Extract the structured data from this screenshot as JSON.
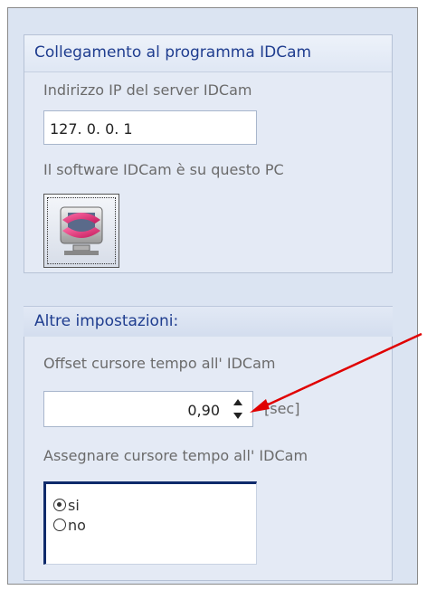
{
  "group_connection": {
    "title": "Collegamento al programma IDCam",
    "ip_label": "Indirizzo IP del server IDCam",
    "ip_value": "127. 0. 0. 1",
    "local_label": "Il software IDCam è su questo PC",
    "app_icon": "idcam-app-icon"
  },
  "group_other": {
    "title": "Altre impostazioni:",
    "offset_label": "Offset cursore tempo all' IDCam",
    "offset_value": "0,90",
    "offset_unit": "[sec]",
    "assign_label": "Assegnare cursore tempo all' IDCam",
    "options": [
      {
        "label": "si",
        "selected": true
      },
      {
        "label": "no",
        "selected": false
      }
    ]
  },
  "annotation": {
    "color": "#e00000",
    "icon": "red-arrow-icon"
  }
}
